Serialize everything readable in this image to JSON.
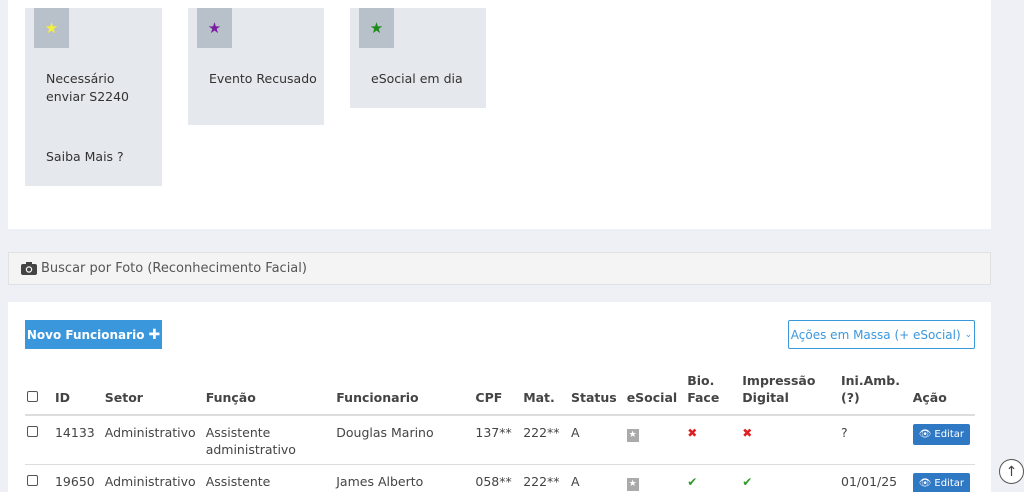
{
  "cards": [
    {
      "text": "Necessário enviar S2240",
      "link": "Saiba Mais ?",
      "star_color": "#f5f03a"
    },
    {
      "text": "Evento Recusado",
      "star_color": "#7b1fa2"
    },
    {
      "text": "eSocial em dia",
      "star_color": "#1b8a1b"
    }
  ],
  "facial_search": {
    "label": "Buscar por Foto (Reconhecimento Facial)",
    "icon": "camera-icon"
  },
  "toolbar": {
    "new_employee_label": "Novo Funcionario",
    "new_employee_icon": "plus-icon",
    "bulk_actions_label": "Ações em Massa (+ eSocial)",
    "bulk_actions_icon": "chevron-down-icon"
  },
  "table": {
    "headers": {
      "id": "ID",
      "setor": "Setor",
      "funcao": "Função",
      "funcionario": "Funcionario",
      "cpf": "CPF",
      "mat": "Mat.",
      "status": "Status",
      "esocial": "eSocial",
      "bio_face": "Bio. Face",
      "impressao": "Impressão Digital",
      "ini_amb": "Ini.Amb. (?)",
      "acao": "Ação"
    },
    "rows": [
      {
        "id": "14133",
        "setor": "Administrativo",
        "funcao": "Assistente administrativo",
        "funcionario": "Douglas Marino",
        "cpf": "137**",
        "mat": "222**",
        "status": "A",
        "bio_face": "no",
        "impressao": "no",
        "ini_amb": "?",
        "acao": "Editar"
      },
      {
        "id": "19650",
        "setor": "Administrativo",
        "funcao": "Assistente",
        "funcionario": "James Alberto Kamradt",
        "cpf": "058**",
        "mat": "222**",
        "status": "A",
        "bio_face": "yes",
        "impressao": "yes",
        "ini_amb": "01/01/25",
        "acao": "Editar"
      }
    ]
  },
  "colors": {
    "primary": "#3b97dc",
    "edit_button": "#2f78c4",
    "error": "#e02020",
    "success": "#2e9a2e"
  }
}
